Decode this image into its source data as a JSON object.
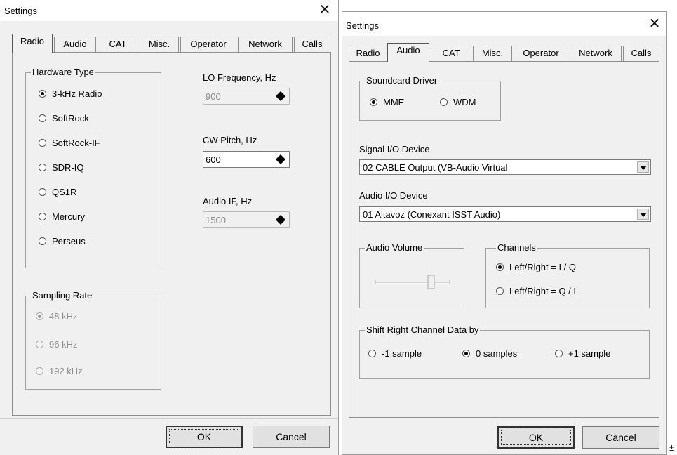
{
  "left_window": {
    "title": "Settings",
    "close_glyph": "✕",
    "tabs": [
      "Radio",
      "Audio",
      "CAT",
      "Misc.",
      "Operator",
      "Network",
      "Calls"
    ],
    "selected_tab": "Radio",
    "hardware_type": {
      "legend": "Hardware Type",
      "options": [
        "3-kHz Radio",
        "SoftRock",
        "SoftRock-IF",
        "SDR-IQ",
        "QS1R",
        "Mercury",
        "Perseus"
      ],
      "selected": "3-kHz Radio"
    },
    "lo_frequency": {
      "label": "LO Frequency, Hz",
      "value": "900",
      "enabled": false
    },
    "cw_pitch": {
      "label": "CW Pitch, Hz",
      "value": "600",
      "enabled": true
    },
    "audio_if": {
      "label": "Audio IF, Hz",
      "value": "1500",
      "enabled": false
    },
    "sampling_rate": {
      "legend": "Sampling Rate",
      "options": [
        "48 kHz",
        "96 kHz",
        "192 kHz"
      ],
      "selected": "48 kHz",
      "enabled": false
    },
    "ok_label": "OK",
    "cancel_label": "Cancel"
  },
  "right_window": {
    "title": "Settings",
    "close_glyph": "✕",
    "tabs": [
      "Radio",
      "Audio",
      "CAT",
      "Misc.",
      "Operator",
      "Network",
      "Calls"
    ],
    "selected_tab": "Audio",
    "soundcard_driver": {
      "legend": "Soundcard Driver",
      "options": [
        "MME",
        "WDM"
      ],
      "selected": "MME"
    },
    "signal_io": {
      "label": "Signal I/O Device",
      "value": "02  CABLE Output (VB-Audio Virtual"
    },
    "audio_io": {
      "label": "Audio I/O Device",
      "value": "01  Altavoz (Conexant ISST Audio)"
    },
    "audio_volume": {
      "legend": "Audio Volume",
      "level": 0.75,
      "enabled": false
    },
    "channels": {
      "legend": "Channels",
      "options": [
        "Left/Right = I / Q",
        "Left/Right = Q / I"
      ],
      "selected": "Left/Right = I / Q"
    },
    "shift": {
      "legend": "Shift Right Channel Data by",
      "options": [
        "-1 sample",
        "0 samples",
        "+1 sample"
      ],
      "selected": "0 samples"
    },
    "ok_label": "OK",
    "cancel_label": "Cancel"
  },
  "corner_glyph": "±"
}
